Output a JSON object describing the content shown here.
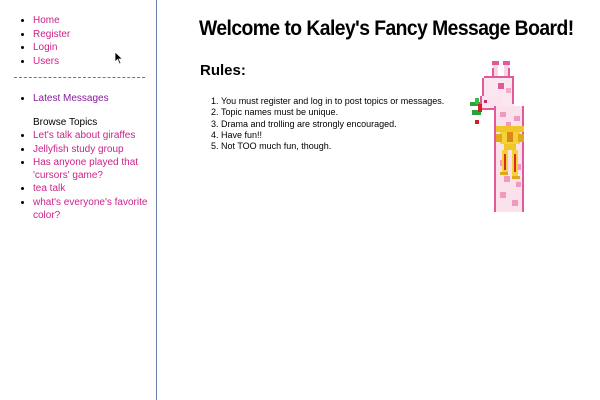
{
  "sidebar": {
    "nav": [
      {
        "label": "Home"
      },
      {
        "label": "Register"
      },
      {
        "label": "Login"
      },
      {
        "label": "Users"
      }
    ],
    "latest_label": "Latest Messages",
    "browse_title": "Browse Topics",
    "topics": [
      {
        "label": "Let's talk about giraffes"
      },
      {
        "label": "Jellyfish study group"
      },
      {
        "label": "Has anyone played that 'cursors' game?"
      },
      {
        "label": "tea talk"
      },
      {
        "label": "what's everyone's favorite color?"
      }
    ]
  },
  "main": {
    "title": "Welcome to Kaley's Fancy Message Board!",
    "rules_heading": "Rules:",
    "rules": [
      "You must register and log in to post topics or messages.",
      "Topic names must be unique.",
      "Drama and trolling are strongly encouraged.",
      "Have fun!!",
      "Not TOO much fun, though."
    ]
  },
  "colors": {
    "link": "#cc2288",
    "visited_link": "#8a1aa0",
    "sidebar_border": "#6b7ea6"
  },
  "icons": [
    "mouse-cursor-icon",
    "giraffe-mascot-icon"
  ]
}
